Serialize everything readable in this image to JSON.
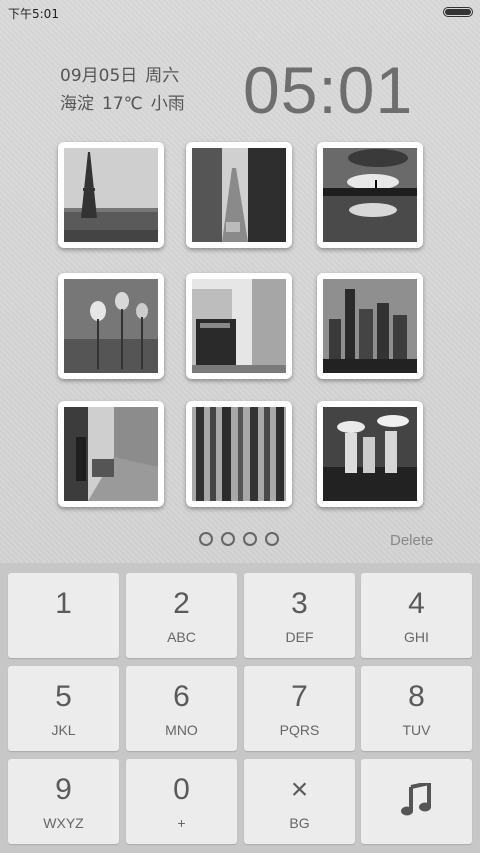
{
  "status_bar": {
    "time": "下午5:01"
  },
  "lockscreen": {
    "date": "09月05日",
    "weekday": "周六",
    "location": "海淀",
    "temperature": "17℃",
    "weather": "小雨",
    "clock": "05:01"
  },
  "photos": [
    {
      "subject": "Eiffel Tower"
    },
    {
      "subject": "city street"
    },
    {
      "subject": "sunset reflection"
    },
    {
      "subject": "dandelions"
    },
    {
      "subject": "pub building"
    },
    {
      "subject": "city skyline"
    },
    {
      "subject": "street with cars"
    },
    {
      "subject": "forest"
    },
    {
      "subject": "people with umbrellas"
    }
  ],
  "pager": {
    "pages": 4
  },
  "delete_label": "Delete",
  "keypad": {
    "keys": [
      {
        "digit": "1",
        "letters": ""
      },
      {
        "digit": "2",
        "letters": "ABC"
      },
      {
        "digit": "3",
        "letters": "DEF"
      },
      {
        "digit": "4",
        "letters": "GHI"
      },
      {
        "digit": "5",
        "letters": "JKL"
      },
      {
        "digit": "6",
        "letters": "MNO"
      },
      {
        "digit": "7",
        "letters": "PQRS"
      },
      {
        "digit": "8",
        "letters": "TUV"
      },
      {
        "digit": "9",
        "letters": "WXYZ"
      },
      {
        "digit": "0",
        "letters": "+"
      },
      {
        "digit": "×",
        "letters": "BG"
      },
      {
        "digit": "",
        "letters": "",
        "icon": "music-note-icon"
      }
    ]
  }
}
